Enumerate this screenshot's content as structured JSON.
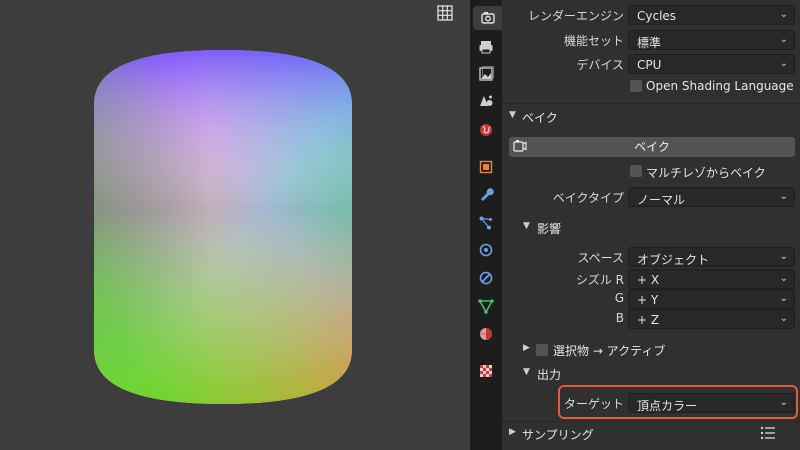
{
  "render": {
    "engine_label": "レンダーエンジン",
    "engine_value": "Cycles",
    "feature_label": "機能セット",
    "feature_value": "標準",
    "device_label": "デバイス",
    "device_value": "CPU",
    "osl_label": "Open Shading Language"
  },
  "bake": {
    "panel_title": "ベイク",
    "button_label": "ベイク",
    "multires_label": "マルチレゾからベイク",
    "type_label": "ベイクタイプ",
    "type_value": "ノーマル",
    "influence": {
      "title": "影響",
      "space_label": "スペース",
      "space_value": "オブジェクト",
      "swizzle_r_label": "シズル R",
      "swizzle_r_value": "+ X",
      "swizzle_g_label": "G",
      "swizzle_g_value": "+ Y",
      "swizzle_b_label": "B",
      "swizzle_b_value": "+ Z"
    },
    "selected_to_active_label": "選択物 → アクティブ",
    "output": {
      "title": "出力",
      "target_label": "ターゲット",
      "target_value": "頂点カラー"
    }
  },
  "sampling": {
    "title": "サンプリング"
  },
  "colors": {
    "highlight": "#e25b3c"
  }
}
